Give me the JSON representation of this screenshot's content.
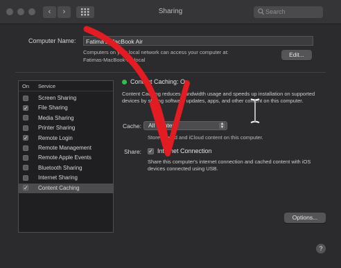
{
  "window": {
    "title": "Sharing",
    "search_placeholder": "Search",
    "nav_back": "‹",
    "nav_forward": "›"
  },
  "computer_name": {
    "label": "Computer Name:",
    "value": "Fatima's MacBook Air",
    "info_line1": "Computers on your local network can access your computer at:",
    "info_line2": "Fatimas-MacBook-Air.local",
    "edit_button": "Edit..."
  },
  "services": {
    "header_on": "On",
    "header_service": "Service",
    "items": [
      {
        "label": "Screen Sharing",
        "checked": false,
        "selected": false
      },
      {
        "label": "File Sharing",
        "checked": true,
        "selected": false
      },
      {
        "label": "Media Sharing",
        "checked": false,
        "selected": false
      },
      {
        "label": "Printer Sharing",
        "checked": false,
        "selected": false
      },
      {
        "label": "Remote Login",
        "checked": true,
        "selected": false
      },
      {
        "label": "Remote Management",
        "checked": false,
        "selected": false
      },
      {
        "label": "Remote Apple Events",
        "checked": false,
        "selected": false
      },
      {
        "label": "Bluetooth Sharing",
        "checked": false,
        "selected": false
      },
      {
        "label": "Internet Sharing",
        "checked": false,
        "selected": false
      },
      {
        "label": "Content Caching",
        "checked": true,
        "selected": true
      }
    ]
  },
  "content_caching": {
    "status": "Content Caching: On",
    "status_color": "#2fc24a",
    "description": "Content Caching reduces bandwidth usage and speeds up installation on supported devices by storing software updates, apps, and other content on this computer.",
    "cache_label": "Cache:",
    "cache_value": "All Content",
    "cache_note": "Store shared and iCloud content on this computer.",
    "share_label": "Share:",
    "share_checkbox": "Internet Connection",
    "share_checked": true,
    "share_desc": "Share this computer's internet connection and cached content with iOS devices connected using USB.",
    "options_button": "Options..."
  },
  "help_button": "?",
  "annotation_color": "#e31b23"
}
